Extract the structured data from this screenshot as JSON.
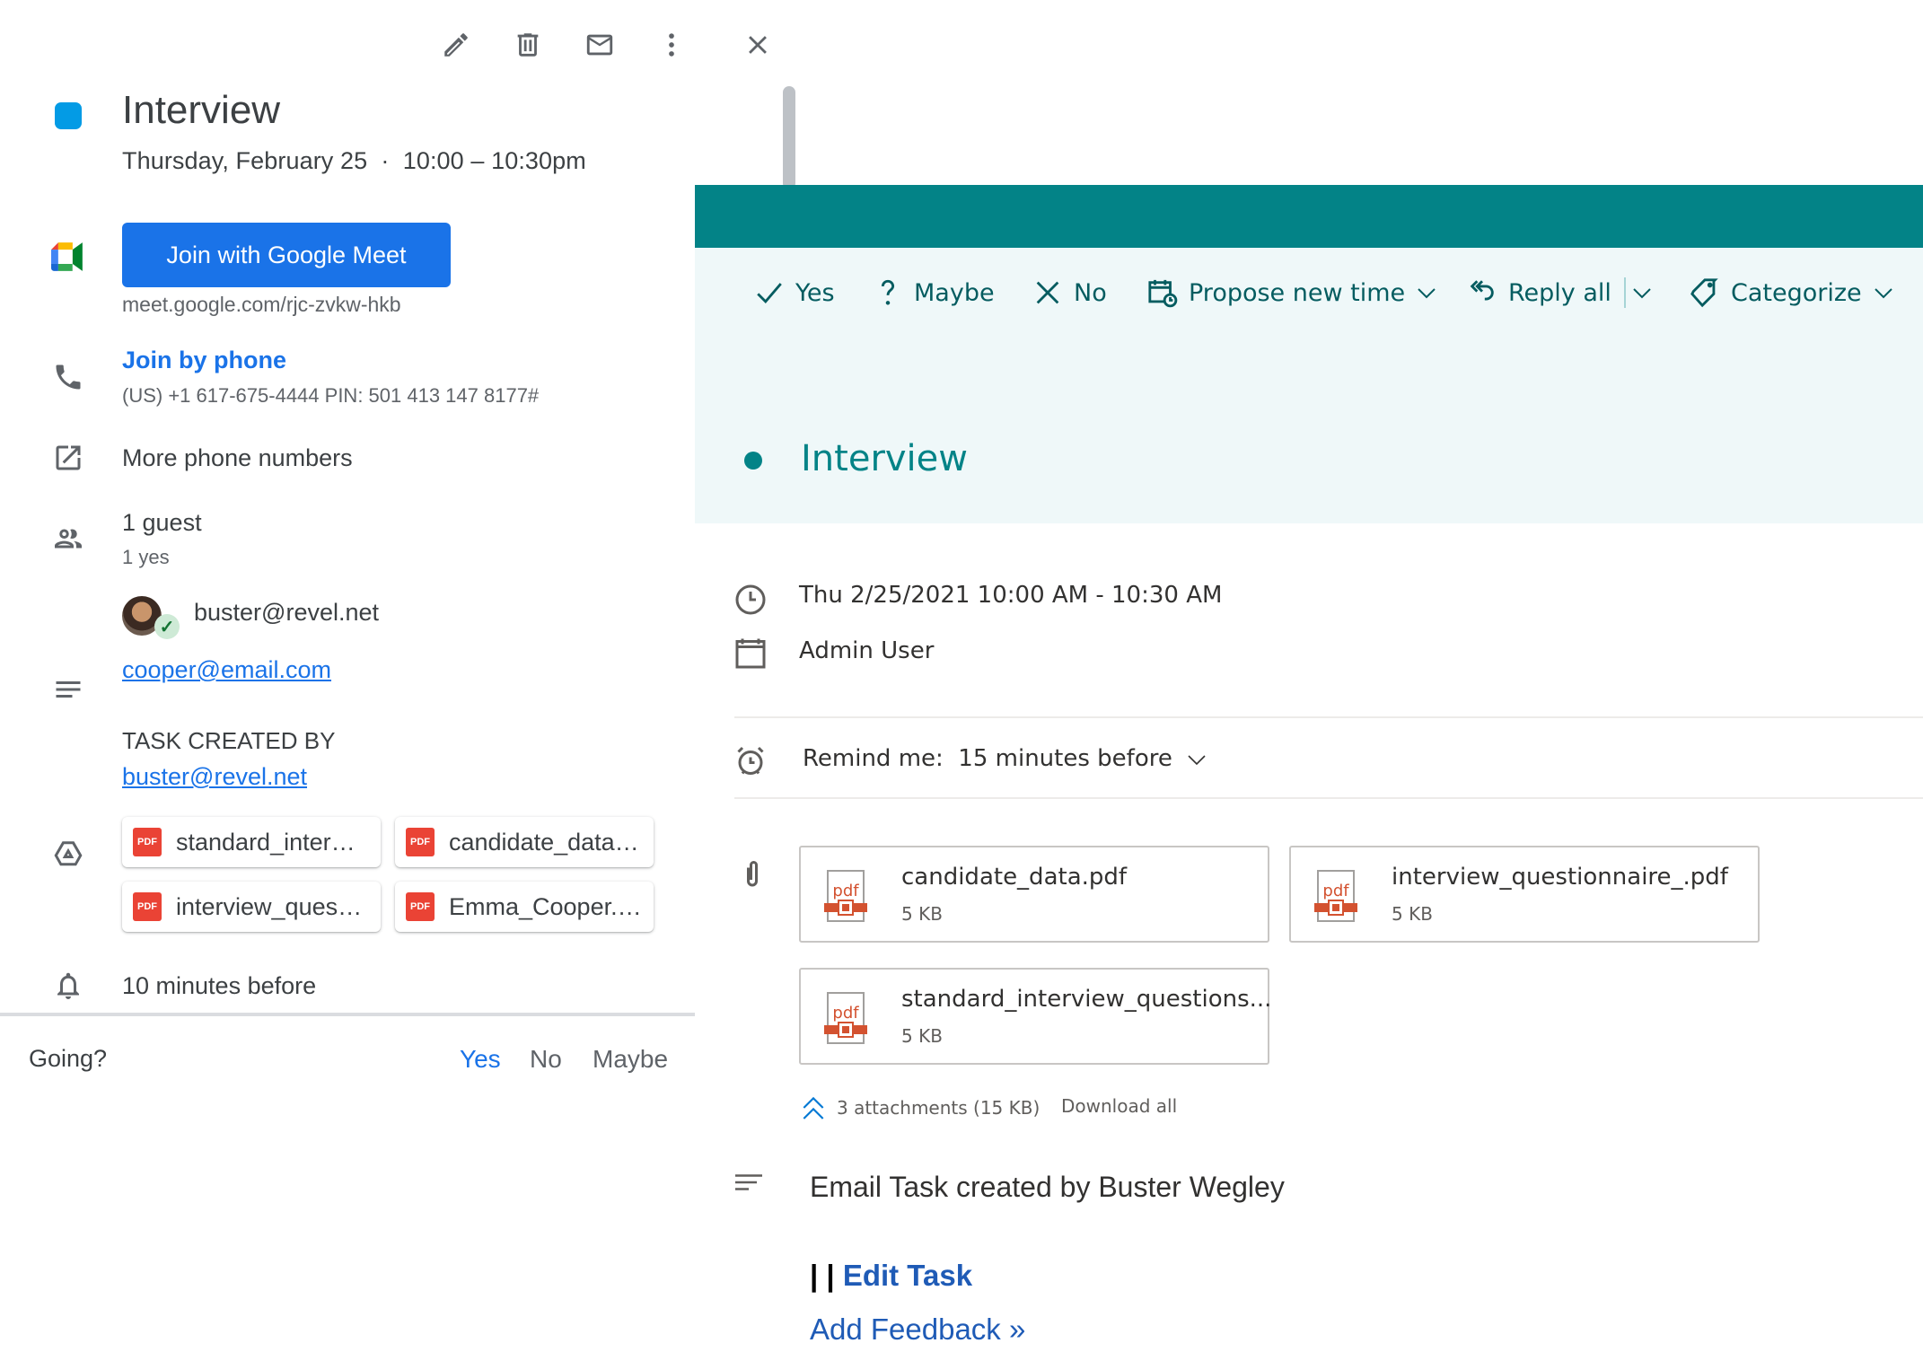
{
  "gcal": {
    "toolbar": {
      "edit": "edit-icon",
      "delete": "trash-icon",
      "email": "mail-icon",
      "more": "more-vert-icon",
      "close": "close-icon"
    },
    "event": {
      "title": "Interview",
      "when": "Thursday, February 25  ·  10:00 – 10:30pm",
      "color": "#039be5"
    },
    "meet": {
      "button_label": "Join with Google Meet",
      "url": "meet.google.com/rjc-zvkw-hkb"
    },
    "phone": {
      "link_label": "Join by phone",
      "detail": "(US) +1 617-675-4444 PIN: 501 413 147 8177#"
    },
    "more_phone_numbers": "More phone numbers",
    "guests": {
      "count": "1 guest",
      "summary": "1 yes",
      "list": [
        {
          "email": "buster@revel.net",
          "status": "accepted"
        }
      ]
    },
    "description": {
      "email": "cooper@email.com",
      "task_created_by_label": "TASK CREATED BY",
      "task_created_by_email": "buster@revel.net"
    },
    "attachments": [
      {
        "name": "standard_inter…",
        "type": "PDF"
      },
      {
        "name": "candidate_data…",
        "type": "PDF"
      },
      {
        "name": "interview_ques…",
        "type": "PDF"
      },
      {
        "name": "Emma_Cooper.…",
        "type": "PDF"
      }
    ],
    "reminder": "10 minutes before",
    "rsvp": {
      "label": "Going?",
      "yes": "Yes",
      "no": "No",
      "maybe": "Maybe",
      "selected": "Yes"
    }
  },
  "outlook": {
    "accent": "#038387",
    "actions": [
      {
        "label": "Yes",
        "icon": "check-icon"
      },
      {
        "label": "Maybe",
        "icon": "question-icon"
      },
      {
        "label": "No",
        "icon": "x-icon"
      },
      {
        "label": "Propose new time",
        "icon": "calendar-clock-icon",
        "dropdown": true
      },
      {
        "label": "Reply all",
        "icon": "reply-all-icon",
        "dropdown": true
      },
      {
        "label": "Categorize",
        "icon": "tag-icon",
        "dropdown": true
      }
    ],
    "title": "Interview",
    "when": "Thu 2/25/2021 10:00 AM - 10:30 AM",
    "organizer": "Admin User",
    "reminder": "Remind me:  15 minutes before",
    "attachments": [
      {
        "name": "candidate_data.pdf",
        "size": "5 KB"
      },
      {
        "name": "interview_questionnaire_.pdf",
        "size": "5 KB"
      },
      {
        "name": "standard_interview_questions...",
        "size": "5 KB"
      }
    ],
    "attachment_summary": "3 attachments (15 KB)",
    "download_all": "Download all",
    "body": {
      "text": "Email Task created by Buster Wegley",
      "bars": "| |",
      "edit_task": "Edit Task",
      "add_feedback": "Add Feedback »"
    }
  }
}
